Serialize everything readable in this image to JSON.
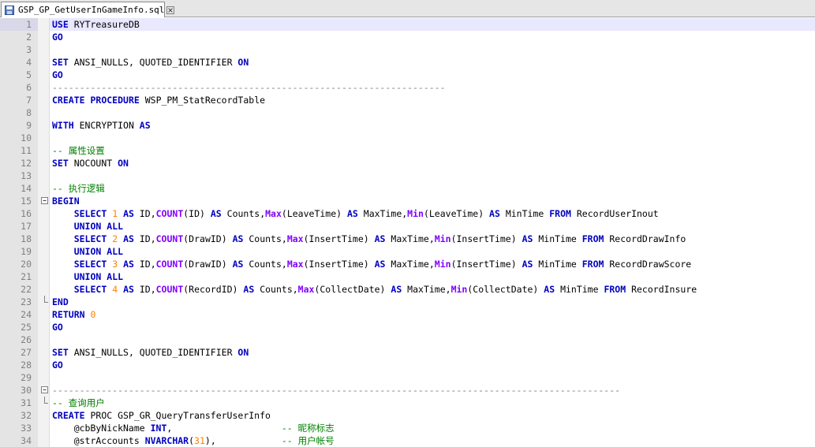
{
  "tab": {
    "label": "GSP_GP_GetUserInGameInfo.sql",
    "icon": "save-icon",
    "close_icon": "close-icon"
  },
  "editor": {
    "current_line": 1,
    "lines": [
      {
        "n": "1",
        "tokens": [
          [
            "kw",
            "USE"
          ],
          [
            "tx",
            " "
          ],
          [
            "id",
            "RYTreasureDB"
          ]
        ]
      },
      {
        "n": "2",
        "tokens": [
          [
            "kw",
            "GO"
          ]
        ]
      },
      {
        "n": "3",
        "tokens": []
      },
      {
        "n": "4",
        "tokens": [
          [
            "kw",
            "SET"
          ],
          [
            "tx",
            " ANSI_NULLS, QUOTED_IDENTIFIER "
          ],
          [
            "kw",
            "ON"
          ]
        ]
      },
      {
        "n": "5",
        "tokens": [
          [
            "kw",
            "GO"
          ]
        ]
      },
      {
        "n": "6",
        "tokens": [
          [
            "dash",
            "------------------------------------------------------------------------"
          ]
        ]
      },
      {
        "n": "7",
        "tokens": [
          [
            "kw",
            "CREATE"
          ],
          [
            "tx",
            " "
          ],
          [
            "kw",
            "PROCEDURE"
          ],
          [
            "tx",
            " WSP_PM_StatRecordTable"
          ]
        ]
      },
      {
        "n": "8",
        "tokens": []
      },
      {
        "n": "9",
        "tokens": [
          [
            "kw",
            "WITH"
          ],
          [
            "tx",
            " ENCRYPTION "
          ],
          [
            "kw",
            "AS"
          ]
        ]
      },
      {
        "n": "10",
        "tokens": []
      },
      {
        "n": "11",
        "tokens": [
          [
            "cm",
            "-- 属性设置"
          ]
        ]
      },
      {
        "n": "12",
        "tokens": [
          [
            "kw",
            "SET"
          ],
          [
            "tx",
            " NOCOUNT "
          ],
          [
            "kw",
            "ON"
          ]
        ]
      },
      {
        "n": "13",
        "tokens": []
      },
      {
        "n": "14",
        "tokens": [
          [
            "cm",
            "-- 执行逻辑"
          ]
        ]
      },
      {
        "n": "15",
        "fold": "open",
        "tokens": [
          [
            "kw",
            "BEGIN"
          ]
        ]
      },
      {
        "n": "16",
        "tokens": [
          [
            "tx",
            "    "
          ],
          [
            "kw",
            "SELECT"
          ],
          [
            "tx",
            " "
          ],
          [
            "num",
            "1"
          ],
          [
            "tx",
            " "
          ],
          [
            "kw",
            "AS"
          ],
          [
            "tx",
            " ID,"
          ],
          [
            "fn",
            "COUNT"
          ],
          [
            "tx",
            "(ID) "
          ],
          [
            "kw",
            "AS"
          ],
          [
            "tx",
            " Counts,"
          ],
          [
            "fn",
            "Max"
          ],
          [
            "tx",
            "(LeaveTime) "
          ],
          [
            "kw",
            "AS"
          ],
          [
            "tx",
            " MaxTime,"
          ],
          [
            "fn",
            "Min"
          ],
          [
            "tx",
            "(LeaveTime) "
          ],
          [
            "kw",
            "AS"
          ],
          [
            "tx",
            " MinTime "
          ],
          [
            "kw",
            "FROM"
          ],
          [
            "tx",
            " RecordUserInout"
          ]
        ]
      },
      {
        "n": "17",
        "tokens": [
          [
            "tx",
            "    "
          ],
          [
            "kw",
            "UNION"
          ],
          [
            "tx",
            " "
          ],
          [
            "kw",
            "ALL"
          ]
        ]
      },
      {
        "n": "18",
        "tokens": [
          [
            "tx",
            "    "
          ],
          [
            "kw",
            "SELECT"
          ],
          [
            "tx",
            " "
          ],
          [
            "num",
            "2"
          ],
          [
            "tx",
            " "
          ],
          [
            "kw",
            "AS"
          ],
          [
            "tx",
            " ID,"
          ],
          [
            "fn",
            "COUNT"
          ],
          [
            "tx",
            "(DrawID) "
          ],
          [
            "kw",
            "AS"
          ],
          [
            "tx",
            " Counts,"
          ],
          [
            "fn",
            "Max"
          ],
          [
            "tx",
            "(InsertTime) "
          ],
          [
            "kw",
            "AS"
          ],
          [
            "tx",
            " MaxTime,"
          ],
          [
            "fn",
            "Min"
          ],
          [
            "tx",
            "(InsertTime) "
          ],
          [
            "kw",
            "AS"
          ],
          [
            "tx",
            " MinTime "
          ],
          [
            "kw",
            "FROM"
          ],
          [
            "tx",
            " RecordDrawInfo"
          ]
        ]
      },
      {
        "n": "19",
        "tokens": [
          [
            "tx",
            "    "
          ],
          [
            "kw",
            "UNION"
          ],
          [
            "tx",
            " "
          ],
          [
            "kw",
            "ALL"
          ]
        ]
      },
      {
        "n": "20",
        "tokens": [
          [
            "tx",
            "    "
          ],
          [
            "kw",
            "SELECT"
          ],
          [
            "tx",
            " "
          ],
          [
            "num",
            "3"
          ],
          [
            "tx",
            " "
          ],
          [
            "kw",
            "AS"
          ],
          [
            "tx",
            " ID,"
          ],
          [
            "fn",
            "COUNT"
          ],
          [
            "tx",
            "(DrawID) "
          ],
          [
            "kw",
            "AS"
          ],
          [
            "tx",
            " Counts,"
          ],
          [
            "fn",
            "Max"
          ],
          [
            "tx",
            "(InsertTime) "
          ],
          [
            "kw",
            "AS"
          ],
          [
            "tx",
            " MaxTime,"
          ],
          [
            "fn",
            "Min"
          ],
          [
            "tx",
            "(InsertTime) "
          ],
          [
            "kw",
            "AS"
          ],
          [
            "tx",
            " MinTime "
          ],
          [
            "kw",
            "FROM"
          ],
          [
            "tx",
            " RecordDrawScore"
          ]
        ]
      },
      {
        "n": "21",
        "tokens": [
          [
            "tx",
            "    "
          ],
          [
            "kw",
            "UNION"
          ],
          [
            "tx",
            " "
          ],
          [
            "kw",
            "ALL"
          ]
        ]
      },
      {
        "n": "22",
        "tokens": [
          [
            "tx",
            "    "
          ],
          [
            "kw",
            "SELECT"
          ],
          [
            "tx",
            " "
          ],
          [
            "num",
            "4"
          ],
          [
            "tx",
            " "
          ],
          [
            "kw",
            "AS"
          ],
          [
            "tx",
            " ID,"
          ],
          [
            "fn",
            "COUNT"
          ],
          [
            "tx",
            "(RecordID) "
          ],
          [
            "kw",
            "AS"
          ],
          [
            "tx",
            " Counts,"
          ],
          [
            "fn",
            "Max"
          ],
          [
            "tx",
            "(CollectDate) "
          ],
          [
            "kw",
            "AS"
          ],
          [
            "tx",
            " MaxTime,"
          ],
          [
            "fn",
            "Min"
          ],
          [
            "tx",
            "(CollectDate) "
          ],
          [
            "kw",
            "AS"
          ],
          [
            "tx",
            " MinTime "
          ],
          [
            "kw",
            "FROM"
          ],
          [
            "tx",
            " RecordInsure"
          ]
        ]
      },
      {
        "n": "23",
        "fold": "end",
        "tokens": [
          [
            "kw",
            "END"
          ]
        ]
      },
      {
        "n": "24",
        "tokens": [
          [
            "kw",
            "RETURN"
          ],
          [
            "tx",
            " "
          ],
          [
            "num",
            "0"
          ]
        ]
      },
      {
        "n": "25",
        "tokens": [
          [
            "kw",
            "GO"
          ]
        ]
      },
      {
        "n": "26",
        "tokens": []
      },
      {
        "n": "27",
        "tokens": [
          [
            "kw",
            "SET"
          ],
          [
            "tx",
            " ANSI_NULLS, QUOTED_IDENTIFIER "
          ],
          [
            "kw",
            "ON"
          ]
        ]
      },
      {
        "n": "28",
        "tokens": [
          [
            "kw",
            "GO"
          ]
        ]
      },
      {
        "n": "29",
        "tokens": []
      },
      {
        "n": "30",
        "fold": "open",
        "tokens": [
          [
            "dash",
            "--------------------------------------------------------------------------------------------------------"
          ]
        ]
      },
      {
        "n": "31",
        "fold": "end",
        "tokens": [
          [
            "cm",
            "-- 查询用户"
          ]
        ]
      },
      {
        "n": "32",
        "tokens": [
          [
            "kw",
            "CREATE"
          ],
          [
            "tx",
            " PROC GSP_GR_QueryTransferUserInfo"
          ]
        ]
      },
      {
        "n": "33",
        "tokens": [
          [
            "tx",
            "    @cbByNickName "
          ],
          [
            "ty",
            "INT"
          ],
          [
            "tx",
            ",                    "
          ],
          [
            "cm",
            "-- 昵称标志"
          ]
        ]
      },
      {
        "n": "34",
        "tokens": [
          [
            "tx",
            "    @strAccounts "
          ],
          [
            "ty",
            "NVARCHAR"
          ],
          [
            "tx",
            "("
          ],
          [
            "num",
            "31"
          ],
          [
            "tx",
            "),            "
          ],
          [
            "cm",
            "-- 用户帐号"
          ]
        ]
      }
    ]
  }
}
